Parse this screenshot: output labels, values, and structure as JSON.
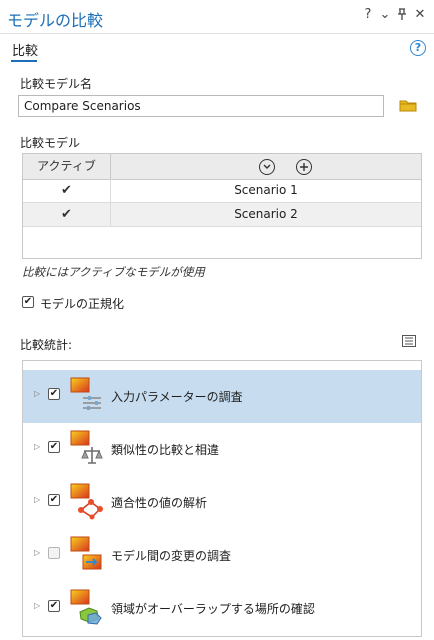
{
  "window": {
    "title": "モデルの比較",
    "controls": [
      "?",
      "⌄",
      "🡣",
      "✕"
    ]
  },
  "tab": {
    "label": "比較"
  },
  "help": {
    "label": "?"
  },
  "model_name": {
    "label": "比較モデル名",
    "value": "Compare Scenarios"
  },
  "models": {
    "label": "比較モデル",
    "column_active": "アクティブ",
    "rows": [
      {
        "active": "✔",
        "name": "Scenario 1"
      },
      {
        "active": "✔",
        "name": "Scenario 2"
      }
    ],
    "hint": "比較にはアクティブなモデルが使用"
  },
  "normalize": {
    "label": "モデルの正規化",
    "checked": true
  },
  "stats": {
    "label": "比較統計:",
    "items": [
      {
        "label": "入力パラメーターの調査",
        "checked": true,
        "icon": "sliders-icon",
        "selected": true
      },
      {
        "label": "類似性の比較と相違",
        "checked": true,
        "icon": "scale-icon",
        "selected": false
      },
      {
        "label": "適合性の値の解析",
        "checked": true,
        "icon": "network-icon",
        "selected": false
      },
      {
        "label": "モデル間の変更の調査",
        "checked": false,
        "icon": "arrow-change-icon",
        "selected": false
      },
      {
        "label": "領域がオーバーラップする場所の確認",
        "checked": true,
        "icon": "overlap-icon",
        "selected": false
      }
    ]
  },
  "colors": {
    "accent": "#1d6fb8",
    "selected_row": "#c7dcef",
    "folder": "#d9a400"
  }
}
